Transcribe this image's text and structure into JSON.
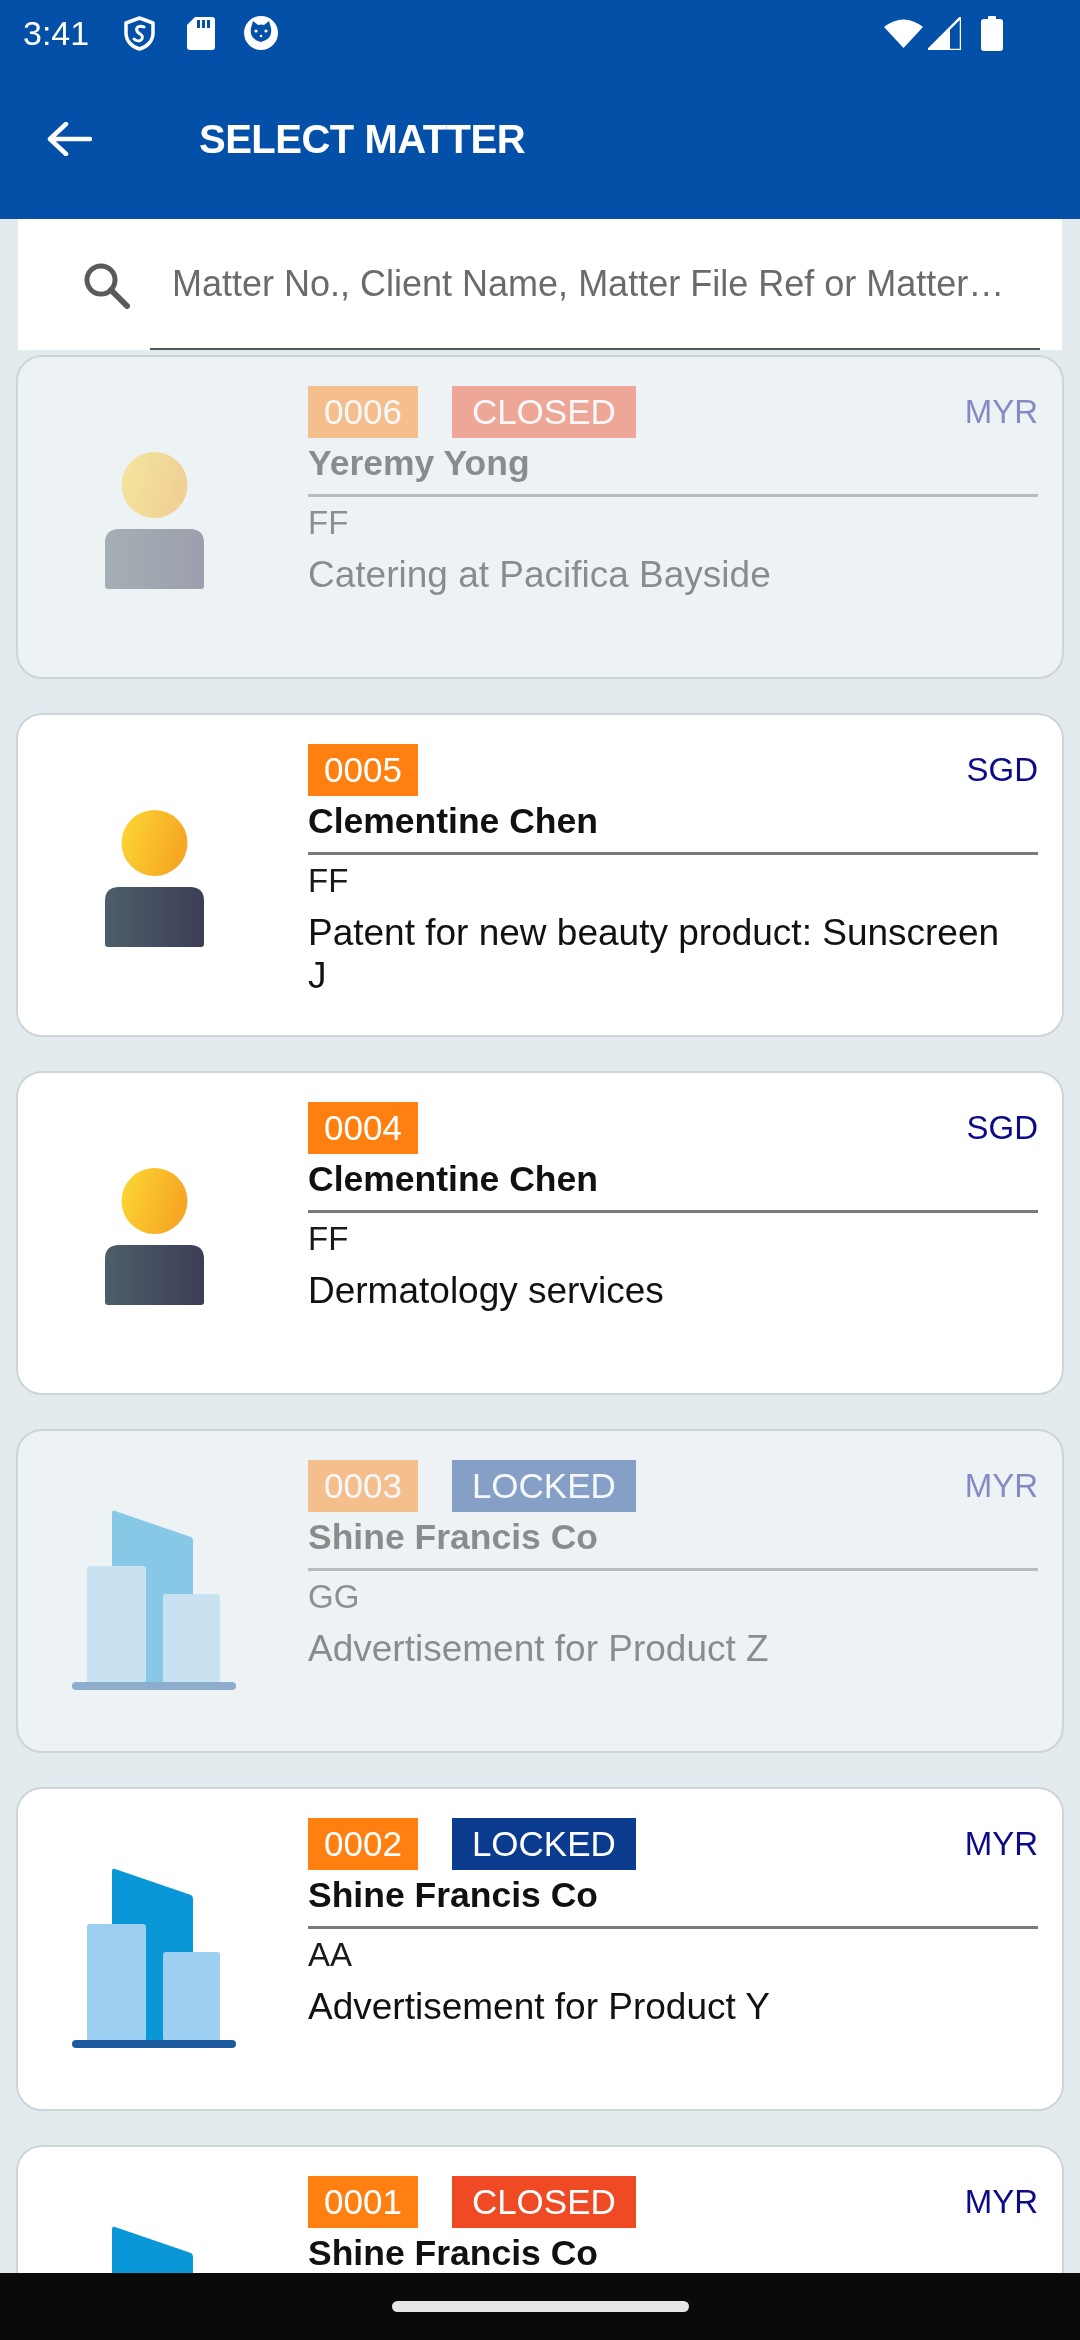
{
  "status_bar": {
    "time": "3:41"
  },
  "app_bar": {
    "title": "SELECT MATTER"
  },
  "search": {
    "placeholder": "Matter No., Client Name, Matter File Ref or Matter…"
  },
  "matters": [
    {
      "kind": "person",
      "disabled": true,
      "number": "0006",
      "status": {
        "label": "CLOSED",
        "kind": "closed"
      },
      "currency": "MYR",
      "client": "Yeremy Yong",
      "code": "FF",
      "description": "Catering at Pacifica Bayside"
    },
    {
      "kind": "person",
      "disabled": false,
      "number": "0005",
      "currency": "SGD",
      "client": "Clementine Chen",
      "code": "FF",
      "description": "Patent for new beauty product: Sunscreen J"
    },
    {
      "kind": "person",
      "disabled": false,
      "number": "0004",
      "currency": "SGD",
      "client": "Clementine Chen",
      "code": "FF",
      "description": "Dermatology services"
    },
    {
      "kind": "company",
      "disabled": true,
      "number": "0003",
      "status": {
        "label": "LOCKED",
        "kind": "locked"
      },
      "currency": "MYR",
      "client": "Shine Francis Co",
      "code": "GG",
      "description": "Advertisement for Product Z"
    },
    {
      "kind": "company",
      "disabled": false,
      "number": "0002",
      "status": {
        "label": "LOCKED",
        "kind": "locked"
      },
      "currency": "MYR",
      "client": "Shine Francis Co",
      "code": "AA",
      "description": "Advertisement for Product Y"
    },
    {
      "kind": "company",
      "disabled": false,
      "number": "0001",
      "status": {
        "label": "CLOSED",
        "kind": "closed"
      },
      "currency": "MYR",
      "client": "Shine Francis Co"
    }
  ]
}
